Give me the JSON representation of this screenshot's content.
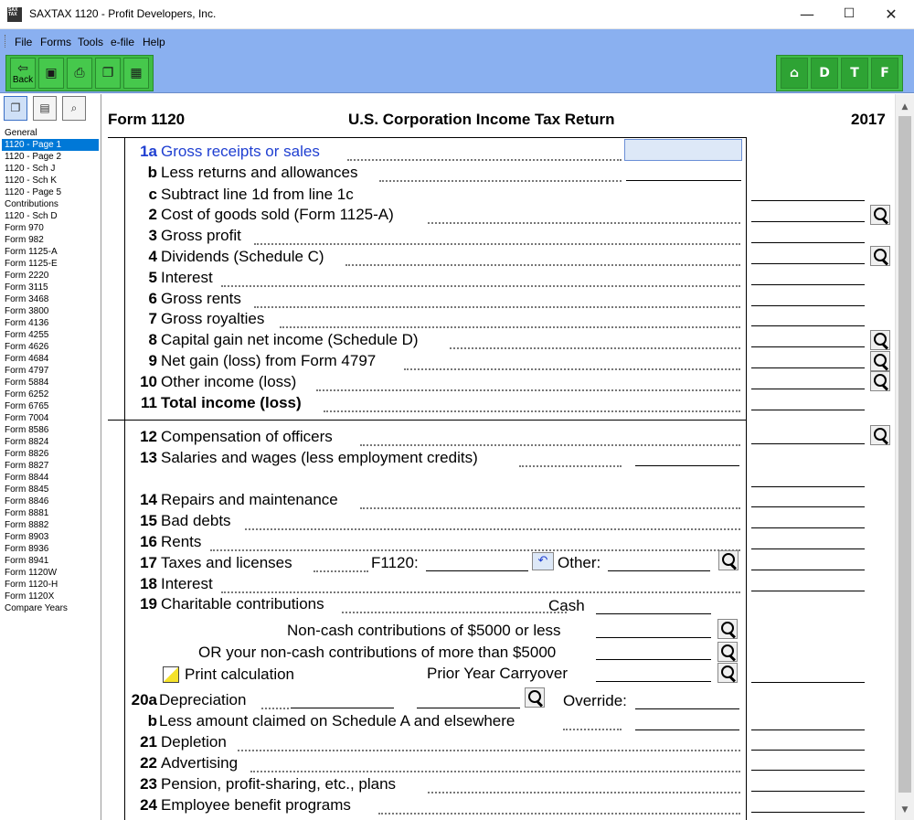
{
  "window": {
    "title": "SAXTAX 1120 - Profit Developers, Inc.",
    "app_icon_text": "SAX TAX",
    "minimize": "—",
    "maximize": "☐",
    "close": "✕"
  },
  "menu": [
    "File",
    "Forms",
    "Tools",
    "e-file",
    "Help"
  ],
  "toolbar": {
    "back_label": "Back",
    "right_labels": {
      "irs_letter": "D",
      "t": "T",
      "f": "F"
    }
  },
  "sidebar": {
    "items": [
      "General",
      "1120 - Page 1",
      "1120 - Page 2",
      "1120 - Sch J",
      "1120 - Sch K",
      "1120 - Page 5",
      "Contributions",
      "1120 - Sch D",
      "Form 970",
      "Form 982",
      "Form 1125-A",
      "Form 1125-E",
      "Form 2220",
      "Form 3115",
      "Form 3468",
      "Form 3800",
      "Form 4136",
      "Form 4255",
      "Form 4626",
      "Form 4684",
      "Form 4797",
      "Form 5884",
      "Form 6252",
      "Form 6765",
      "Form 7004",
      "Form 8586",
      "Form 8824",
      "Form 8826",
      "Form 8827",
      "Form 8844",
      "Form 8845",
      "Form 8846",
      "Form 8881",
      "Form 8882",
      "Form 8903",
      "Form 8936",
      "Form 8941",
      "Form 1120W",
      "Form 1120-H",
      "Form 1120X",
      "Compare Years"
    ],
    "selected": "1120 - Page 1"
  },
  "form": {
    "form_label": "Form 1120",
    "title": "U.S. Corporation Income Tax Return",
    "year": "2017",
    "lines": {
      "l1a": {
        "num": "1a",
        "label": "Gross receipts or sales"
      },
      "l1b": {
        "num": "b",
        "label": "Less returns and allowances"
      },
      "l1c": {
        "num": "c",
        "label": "Subtract line 1d from line 1c"
      },
      "l2": {
        "num": "2",
        "label": "Cost of goods sold (Form 1125-A)"
      },
      "l3": {
        "num": "3",
        "label": "Gross profit"
      },
      "l4": {
        "num": "4",
        "label": "Dividends (Schedule C)"
      },
      "l5": {
        "num": "5",
        "label": "Interest"
      },
      "l6": {
        "num": "6",
        "label": "Gross rents"
      },
      "l7": {
        "num": "7",
        "label": "Gross royalties"
      },
      "l8": {
        "num": "8",
        "label": "Capital gain net income (Schedule D)"
      },
      "l9": {
        "num": "9",
        "label": "Net gain (loss) from Form 4797"
      },
      "l10": {
        "num": "10",
        "label": "Other income (loss)"
      },
      "l11": {
        "num": "11",
        "label": "Total income (loss)"
      },
      "l12": {
        "num": "12",
        "label": "Compensation of officers"
      },
      "l13": {
        "num": "13",
        "label": "Salaries and wages (less employment credits)"
      },
      "l14": {
        "num": "14",
        "label": "Repairs and maintenance"
      },
      "l15": {
        "num": "15",
        "label": "Bad debts"
      },
      "l16": {
        "num": "16",
        "label": "Rents"
      },
      "l17": {
        "num": "17",
        "label": "Taxes and licenses",
        "f1120": "F1120:",
        "other": "Other:"
      },
      "l18": {
        "num": "18",
        "label": "Interest"
      },
      "l19": {
        "num": "19",
        "label": "Charitable contributions",
        "cash": "Cash"
      },
      "noncash_less": "Non-cash contributions of $5000 or less",
      "noncash_more": "OR your non-cash contributions of more than $5000",
      "print_calc": "Print calculation",
      "prior_year": "Prior Year Carryover",
      "l20a": {
        "num": "20a",
        "label": "Depreciation",
        "override": "Override:"
      },
      "l20b": {
        "num": "b",
        "label": "Less amount claimed on Schedule A and elsewhere"
      },
      "l21": {
        "num": "21",
        "label": "Depletion"
      },
      "l22": {
        "num": "22",
        "label": "Advertising"
      },
      "l23": {
        "num": "23",
        "label": "Pension, profit-sharing, etc., plans"
      },
      "l24": {
        "num": "24",
        "label": "Employee benefit programs"
      }
    }
  }
}
